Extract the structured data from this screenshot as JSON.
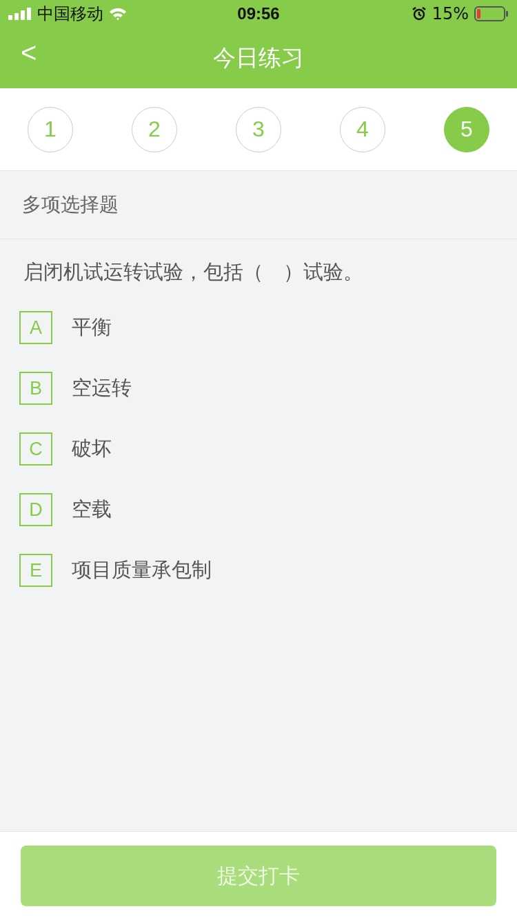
{
  "status_bar": {
    "carrier": "中国移动",
    "time": "09:56",
    "battery": "15%"
  },
  "header": {
    "back": "<",
    "title": "今日练习"
  },
  "steps": [
    {
      "label": "1",
      "selected": false
    },
    {
      "label": "2",
      "selected": false
    },
    {
      "label": "3",
      "selected": false
    },
    {
      "label": "4",
      "selected": false
    },
    {
      "label": "5",
      "selected": true
    }
  ],
  "section": {
    "title": "多项选择题"
  },
  "question": {
    "text": "启闭机试运转试验，包括（　）试验。"
  },
  "options": [
    {
      "letter": "A",
      "text": "平衡",
      "checked": false
    },
    {
      "letter": "B",
      "text": "空运转",
      "checked": false
    },
    {
      "letter": "C",
      "text": "破坏",
      "checked": false
    },
    {
      "letter": "D",
      "text": "空载",
      "checked": false
    },
    {
      "letter": "E",
      "text": "项目质量承包制",
      "checked": false
    }
  ],
  "submit": {
    "label": "提交打卡",
    "disabled": true
  }
}
